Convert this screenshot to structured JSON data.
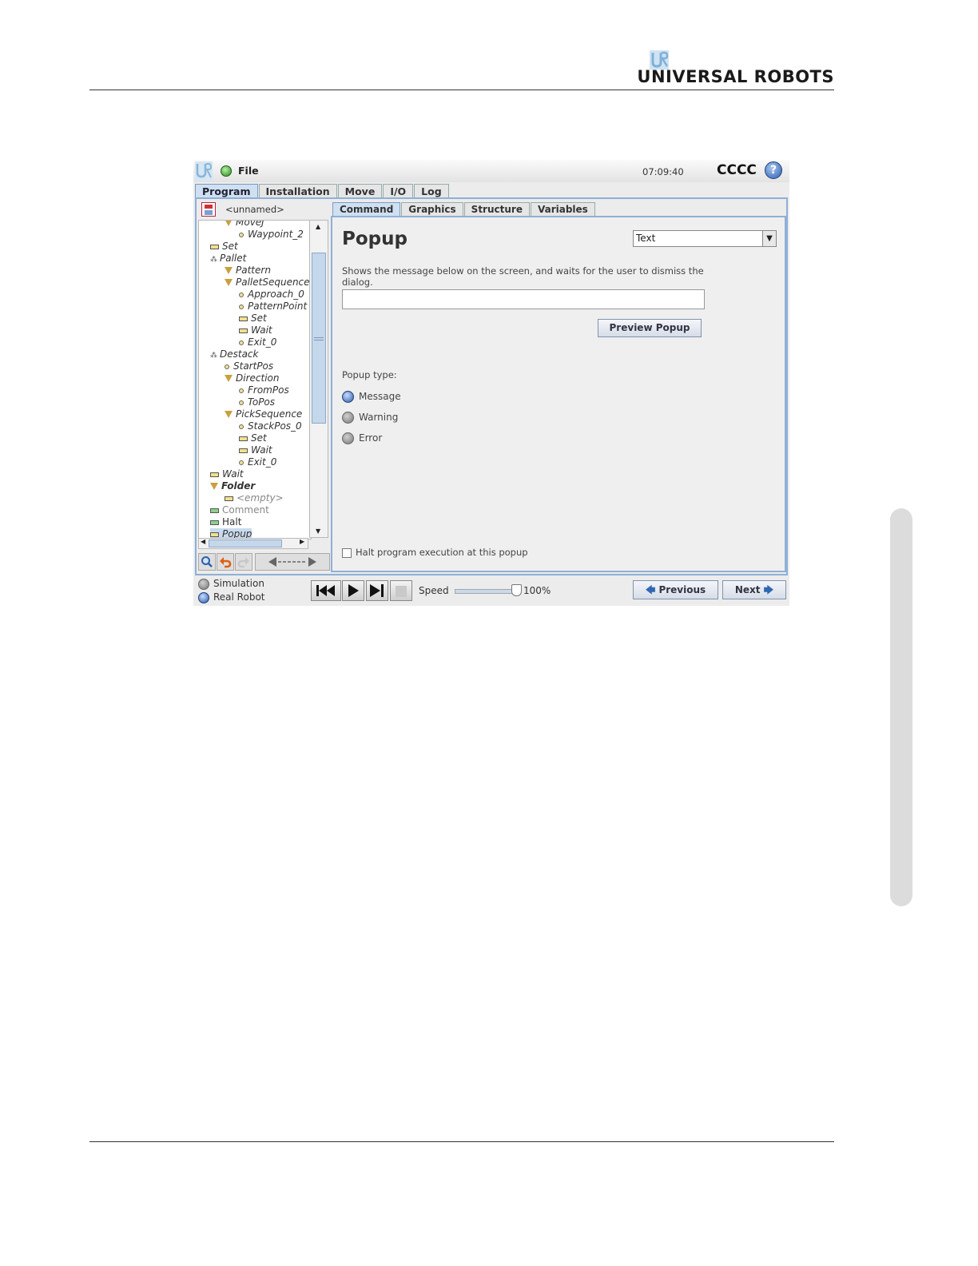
{
  "page": {
    "brand_name": "UNIVERSAL ROBOTS",
    "brand_logo": "UR"
  },
  "app": {
    "menu_file": "File",
    "clock": "07:09:40",
    "robot_name": "CCCC",
    "help_icon": "?",
    "main_tabs": [
      "Program",
      "Installation",
      "Move",
      "I/O",
      "Log"
    ],
    "program_name": "<unnamed>",
    "tree": [
      {
        "label": "MoveJ",
        "icon": "triangle"
      },
      {
        "label": "Waypoint_2",
        "icon": "dot"
      },
      {
        "label": "Set",
        "icon": "bar"
      },
      {
        "label": "Pallet",
        "icon": "pallet"
      },
      {
        "label": "Pattern",
        "icon": "triangle"
      },
      {
        "label": "PalletSequence",
        "icon": "triangle"
      },
      {
        "label": "Approach_0",
        "icon": "dot"
      },
      {
        "label": "PatternPoint",
        "icon": "dot"
      },
      {
        "label": "Set",
        "icon": "bar"
      },
      {
        "label": "Wait",
        "icon": "bar"
      },
      {
        "label": "Exit_0",
        "icon": "dot"
      },
      {
        "label": "Destack",
        "icon": "pallet"
      },
      {
        "label": "StartPos",
        "icon": "dot"
      },
      {
        "label": "Direction",
        "icon": "triangle"
      },
      {
        "label": "FromPos",
        "icon": "dot"
      },
      {
        "label": "ToPos",
        "icon": "dot"
      },
      {
        "label": "PickSequence",
        "icon": "triangle"
      },
      {
        "label": "StackPos_0",
        "icon": "dot"
      },
      {
        "label": "Set",
        "icon": "bar"
      },
      {
        "label": "Wait",
        "icon": "bar"
      },
      {
        "label": "Exit_0",
        "icon": "dot"
      },
      {
        "label": "Wait",
        "icon": "bar"
      },
      {
        "label": "Folder",
        "icon": "triangle"
      },
      {
        "label": "<empty>",
        "icon": "bar"
      },
      {
        "label": "Comment",
        "icon": "bar-green"
      },
      {
        "label": "Halt",
        "icon": "bar-green"
      },
      {
        "label": "Popup",
        "icon": "bar",
        "selected": true
      }
    ],
    "sub_tabs": [
      "Command",
      "Graphics",
      "Structure",
      "Variables"
    ],
    "popup": {
      "title": "Popup",
      "type_select_value": "Text",
      "description": "Shows the message below on the screen, and waits for the user to dismiss the dialog.",
      "message_value": "",
      "preview_button": "Preview Popup",
      "popup_type_label": "Popup type:",
      "types": [
        "Message",
        "Warning",
        "Error"
      ],
      "selected_type": "Message",
      "halt_checkbox_label": "Halt program execution at this popup",
      "halt_checked": false
    },
    "footer": {
      "simulation_label": "Simulation",
      "real_robot_label": "Real Robot",
      "selected_mode": "Real Robot",
      "speed_label": "Speed",
      "speed_value": "100%",
      "speed_fraction": 1.0,
      "previous_button": "Previous",
      "next_button": "Next"
    }
  }
}
